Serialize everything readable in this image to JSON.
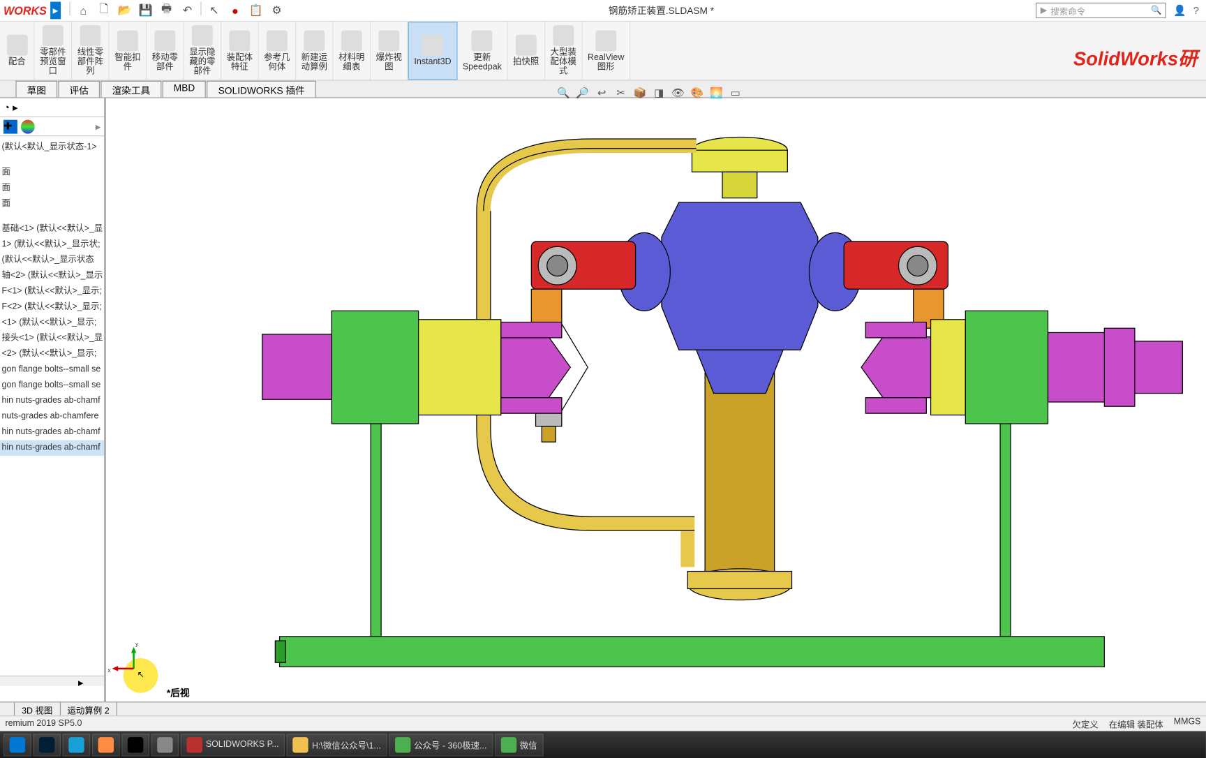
{
  "title": "钢筋矫正装置.SLDASM *",
  "logo": "WORKS",
  "search_placeholder": "搜索命令",
  "watermark": "SolidWorks研",
  "ribbon": [
    {
      "label": "配合"
    },
    {
      "label": "零部件\n预览窗\n口"
    },
    {
      "label": "线性零\n部件阵\n列"
    },
    {
      "label": "智能扣\n件"
    },
    {
      "label": "移动零\n部件"
    },
    {
      "label": "显示隐\n藏的零\n部件"
    },
    {
      "label": "装配体\n特征"
    },
    {
      "label": "参考几\n何体"
    },
    {
      "label": "新建运\n动算例"
    },
    {
      "label": "材料明\n细表"
    },
    {
      "label": "爆炸视\n图"
    },
    {
      "label": "Instant3D",
      "active": true
    },
    {
      "label": "更新\nSpeedpak"
    },
    {
      "label": "拍快照"
    },
    {
      "label": "大型装\n配体模\n式"
    },
    {
      "label": "RealView\n图形"
    }
  ],
  "tabs": [
    "草图",
    "评估",
    "渲染工具",
    "MBD",
    "SOLIDWORKS 插件"
  ],
  "tree": {
    "top": "(默认<默认_显示状态-1>",
    "planes": [
      "面",
      "面",
      "面"
    ],
    "items": [
      "基础<1> (默认<<默认>_显",
      "1> (默认<<默认>_显示状;",
      "(默认<<默认>_显示状态",
      "轴<2> (默认<<默认>_显示",
      "F<1> (默认<<默认>_显示;",
      "F<2> (默认<<默认>_显示;",
      "<1> (默认<<默认>_显示;",
      "接头<1> (默认<<默认>_显",
      "<2> (默认<<默认>_显示;",
      "gon flange bolts--small se",
      "gon flange bolts--small se",
      "hin nuts-grades ab-chamf",
      "nuts-grades ab-chamfere",
      "hin nuts-grades ab-chamf",
      "hin nuts-grades ab-chamf"
    ]
  },
  "view_label": "*后视",
  "bottom_tabs": [
    "",
    "3D 视图",
    "运动算例 2"
  ],
  "status": {
    "left": "remium 2019 SP5.0",
    "right": [
      "欠定义",
      "在编辑 装配体",
      "MMGS"
    ]
  },
  "taskbar": [
    {
      "icon": "#0078d4",
      "label": ""
    },
    {
      "icon": "#001e36",
      "label": ""
    },
    {
      "icon": "#1a9fd9",
      "label": ""
    },
    {
      "icon": "#ff8c42",
      "label": ""
    },
    {
      "icon": "#000",
      "label": ""
    },
    {
      "icon": "#888",
      "label": ""
    },
    {
      "icon": "#b8312f",
      "label": "SOLIDWORKS P..."
    },
    {
      "icon": "#f0c050",
      "label": "H:\\微信公众号\\1..."
    },
    {
      "icon": "#4caf50",
      "label": "公众号 - 360极速..."
    },
    {
      "icon": "#4caf50",
      "label": "微信"
    }
  ]
}
